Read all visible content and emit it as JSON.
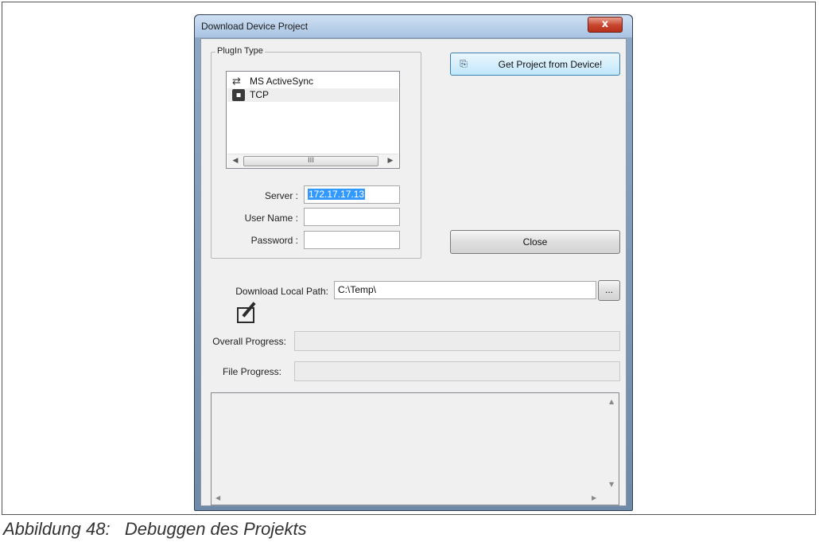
{
  "window": {
    "title": "Download Device Project",
    "close_glyph": "x"
  },
  "plugin": {
    "legend": "PlugIn Type",
    "items": [
      {
        "label": "MS ActiveSync",
        "icon": "sync-icon"
      },
      {
        "label": "TCP",
        "icon": "network-icon"
      }
    ],
    "scroll_thumb_glyph": "III"
  },
  "fields": {
    "server_label": "Server :",
    "server_value": "172.17.17.13",
    "username_label": "User Name :",
    "username_value": "",
    "password_label": "Password :",
    "password_value": ""
  },
  "buttons": {
    "get_project": "Get Project from Device!",
    "close": "Close",
    "browse": "..."
  },
  "download": {
    "path_label": "Download Local Path:",
    "path_value": "C:\\Temp\\"
  },
  "progress": {
    "overall_label": "Overall Progress:",
    "overall_value": 0,
    "file_label": "File Progress:",
    "file_value": 0
  },
  "caption": "Abbildung 48:   Debuggen des Projekts"
}
